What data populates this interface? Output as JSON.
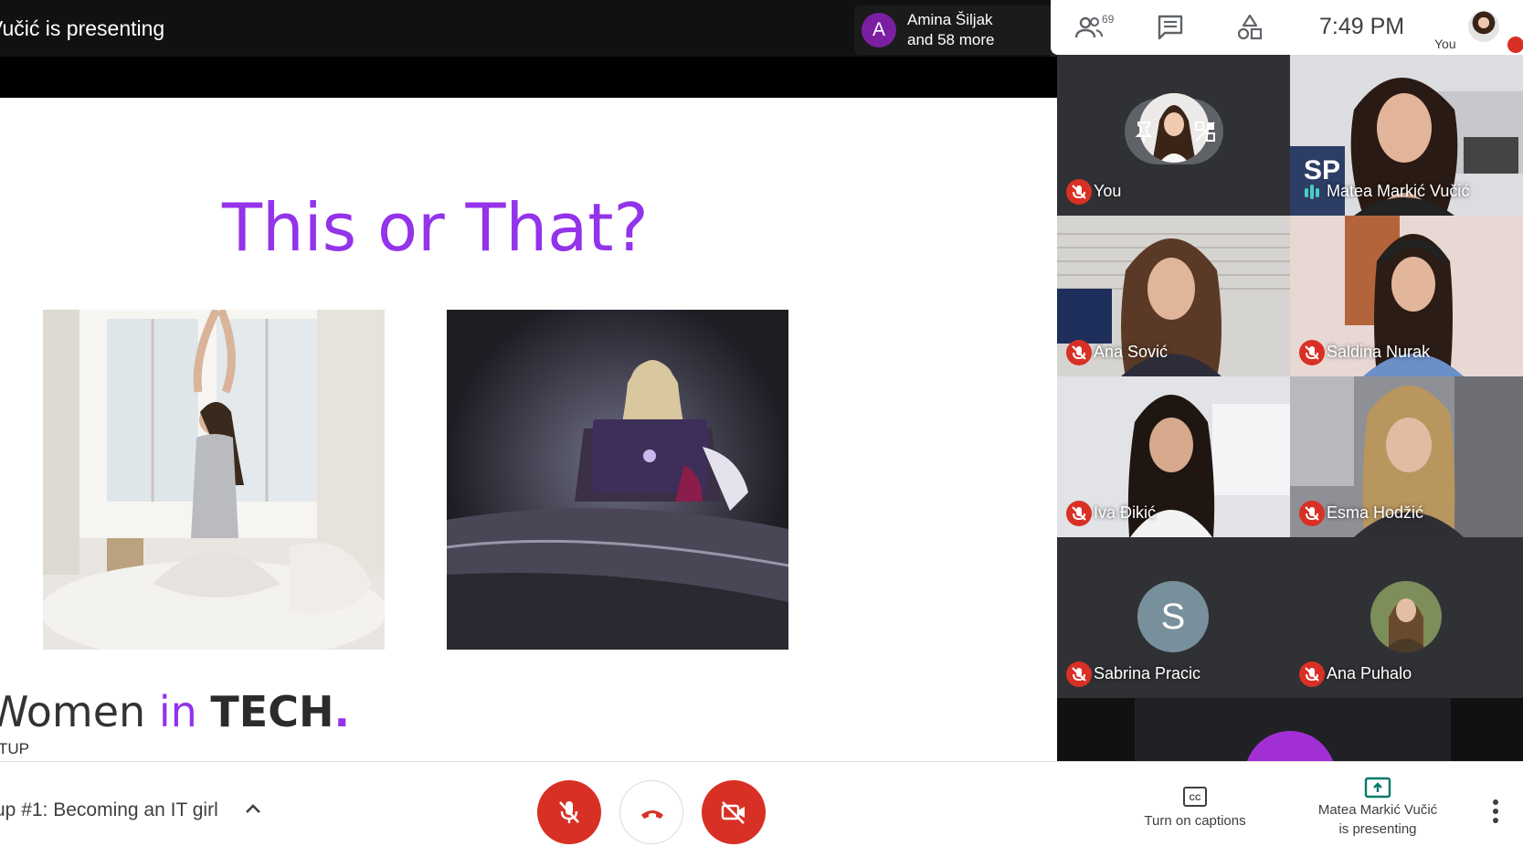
{
  "topbar": {
    "presenting_title": "Vučić is presenting",
    "participants_chip": {
      "avatar_letter": "A",
      "name": "Amina Šiljak",
      "more": "and 58 more"
    }
  },
  "header": {
    "people_count": "69",
    "time": "7:49 PM",
    "self_label": "You"
  },
  "slide": {
    "title": "This or That?",
    "brand": {
      "prefix": "Women",
      "in": " in ",
      "tech": "TECH",
      "dot": "."
    },
    "subtitle": "TUP"
  },
  "tiles": [
    {
      "name": "You",
      "status": "muted"
    },
    {
      "name": "Matea Markić Vučić",
      "status": "speaking"
    },
    {
      "name": "Ana Sović",
      "status": "muted"
    },
    {
      "name": "Saldina Nurak",
      "status": "muted"
    },
    {
      "name": "Iva Đikić",
      "status": "muted"
    },
    {
      "name": "Esma Hodžić",
      "status": "muted"
    },
    {
      "name": "Sabrina Pracic",
      "status": "muted",
      "avatar_letter": "S"
    },
    {
      "name": "Ana Puhalo",
      "status": "muted"
    }
  ],
  "bottombar": {
    "meeting_title": "up #1: Becoming an IT girl",
    "captions_label": "Turn on captions",
    "presenting_line1": "Matea Markić Vučić",
    "presenting_line2": "is presenting"
  },
  "colors": {
    "mute_red": "#d93025",
    "accent_purple": "#9333ea",
    "present_teal": "#00796b"
  }
}
